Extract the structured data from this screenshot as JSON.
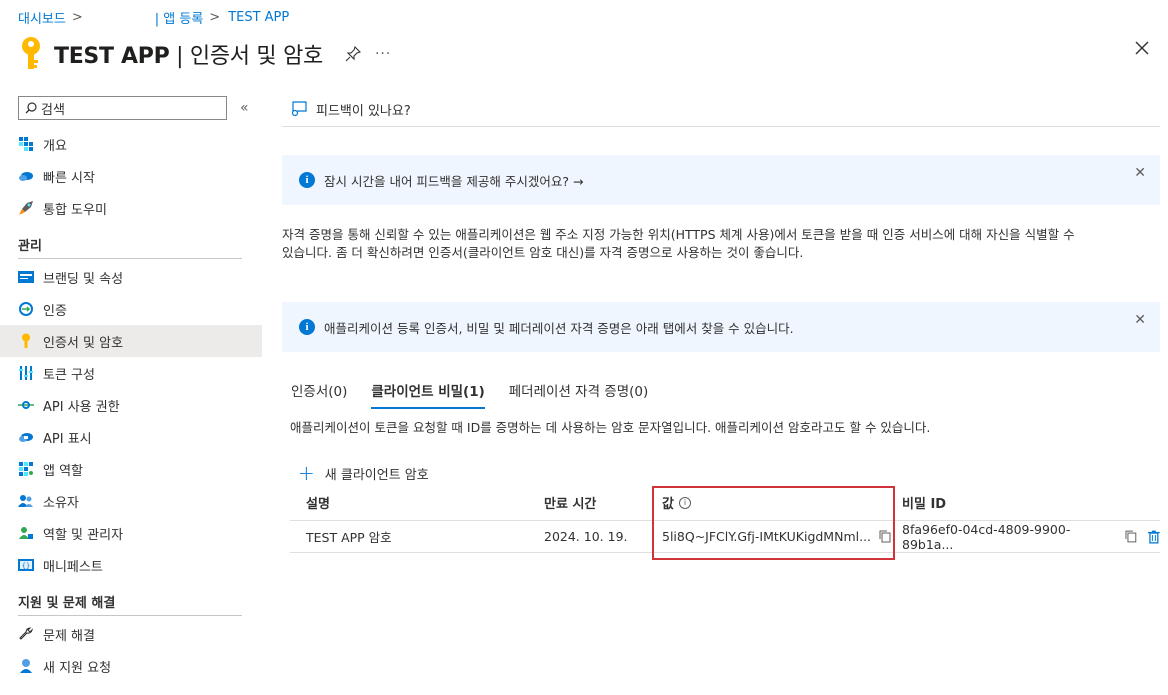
{
  "breadcrumb": {
    "home": "대시보드",
    "app_reg": "| 앱 등록",
    "app": "TEST APP"
  },
  "header": {
    "title": "TEST APP",
    "subtitle": " | 인증서 및 암호",
    "more": "···"
  },
  "sidebar": {
    "search_placeholder": "검색",
    "collapse": "«",
    "items_top": [
      {
        "label": "개요",
        "icon": "overview-icon"
      },
      {
        "label": "빠른 시작",
        "icon": "cloud-icon"
      },
      {
        "label": "통합 도우미",
        "icon": "rocket-icon"
      }
    ],
    "section_manage": "관리",
    "items_manage": [
      {
        "label": "브랜딩 및 속성",
        "icon": "branding-icon"
      },
      {
        "label": "인증",
        "icon": "auth-icon"
      },
      {
        "label": "인증서 및 암호",
        "icon": "key-icon"
      },
      {
        "label": "토큰 구성",
        "icon": "token-icon"
      },
      {
        "label": "API 사용 권한",
        "icon": "api-permission-icon"
      },
      {
        "label": "API 표시",
        "icon": "api-expose-icon"
      },
      {
        "label": "앱 역할",
        "icon": "app-roles-icon"
      },
      {
        "label": "소유자",
        "icon": "owners-icon"
      },
      {
        "label": "역할 및 관리자",
        "icon": "roles-admin-icon"
      },
      {
        "label": "매니페스트",
        "icon": "manifest-icon"
      }
    ],
    "section_support": "지원 및 문제 해결",
    "items_support": [
      {
        "label": "문제 해결",
        "icon": "wrench-icon"
      },
      {
        "label": "새 지원 요청",
        "icon": "support-request-icon"
      }
    ]
  },
  "main": {
    "feedback": "피드백이 있나요?",
    "banner1": "잠시 시간을 내어 피드백을 제공해 주시겠어요? →",
    "description_line1": "자격 증명을 통해 신뢰할 수 있는 애플리케이션은 웹 주소 지정 가능한 위치(HTTPS 체계 사용)에서 토큰을 받을 때 인증 서비스에 대해 자신을 식별할 수",
    "description_line2": "있습니다. 좀 더 확신하려면 인증서(클라이언트 암호 대신)를 자격 증명으로 사용하는 것이 좋습니다.",
    "banner2": "애플리케이션 등록 인증서, 비밀 및 페더레이션 자격 증명은 아래 탭에서 찾을 수 있습니다.",
    "tabs": [
      {
        "label": "인증서(0)"
      },
      {
        "label": "클라이언트 비밀(1)"
      },
      {
        "label": "페더레이션 자격 증명(0)"
      }
    ],
    "tab_desc": "애플리케이션이 토큰을 요청할 때 ID를 증명하는 데 사용하는 암호 문자열입니다. 애플리케이션 암호라고도 할 수 있습니다.",
    "add_button": "새 클라이언트 암호",
    "table": {
      "headers": [
        "설명",
        "만료 시간",
        "값",
        "비밀 ID"
      ],
      "rows": [
        {
          "description": "TEST APP 암호",
          "expires": "2024. 10. 19.",
          "value": "5li8Q~JFClY.Gfj-IMtKUKigdMNml...",
          "secret_id": "8fa96ef0-04cd-4809-9900-89b1a..."
        }
      ]
    }
  }
}
